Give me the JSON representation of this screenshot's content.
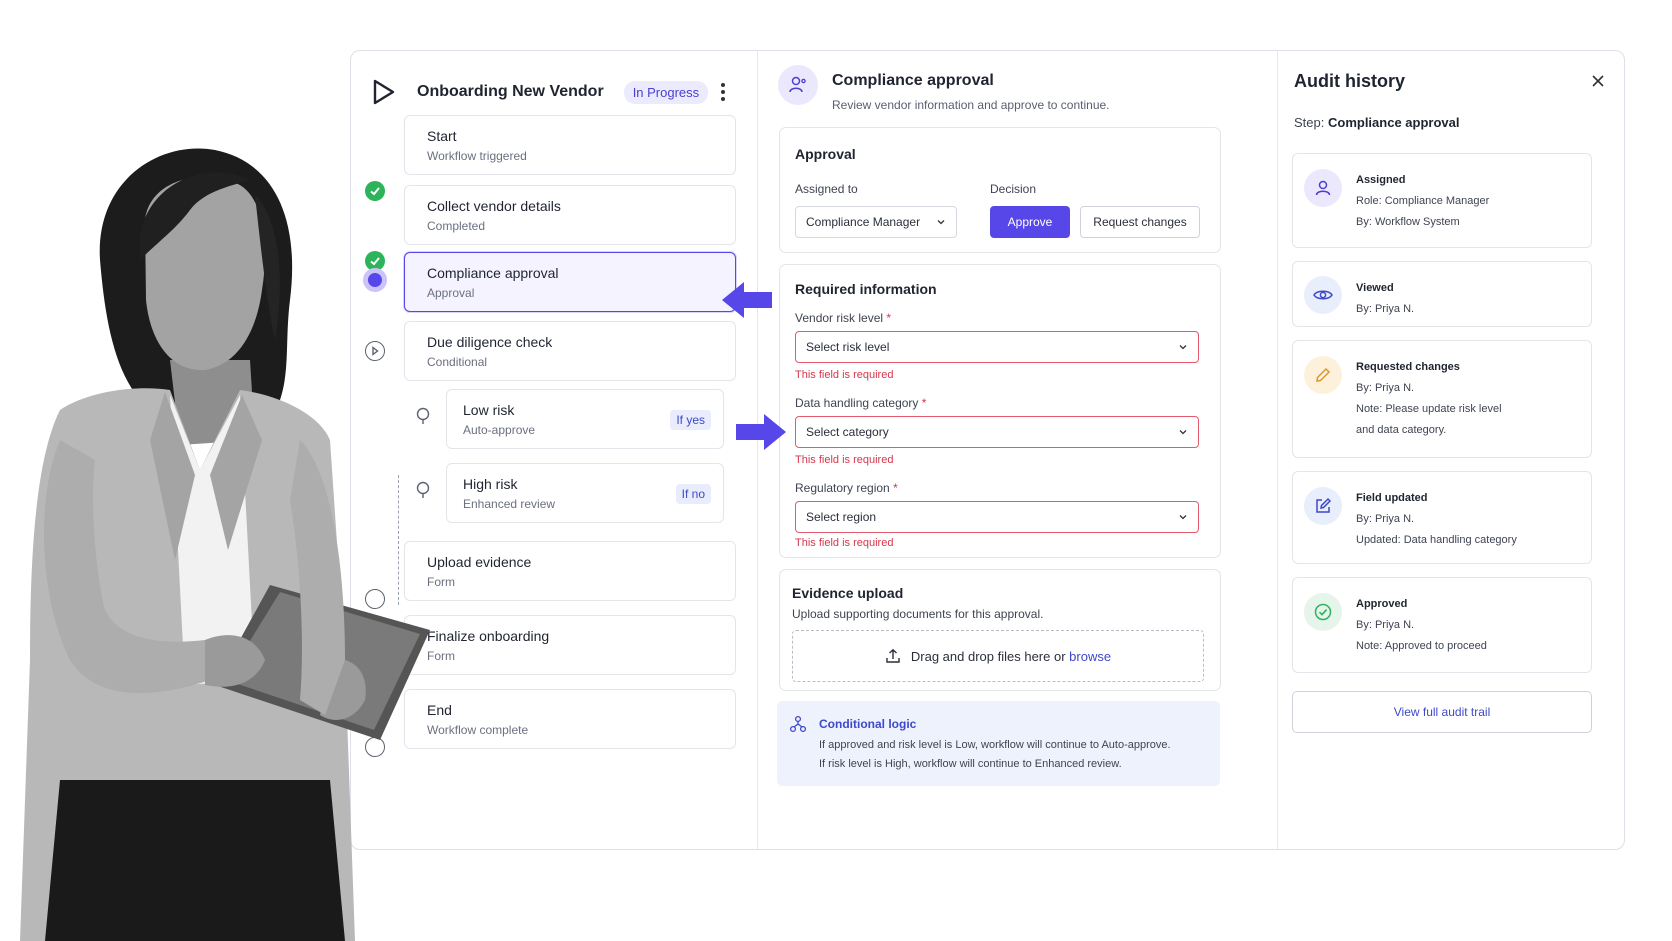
{
  "workflow": {
    "title": "Onboarding New Vendor",
    "status": "In Progress",
    "steps": [
      {
        "title": "Start",
        "subtitle": "Workflow triggered"
      },
      {
        "title": "Collect vendor details",
        "subtitle": "Completed"
      },
      {
        "title": "Compliance approval",
        "subtitle": "Approval"
      },
      {
        "title": "Due diligence check",
        "subtitle": "Conditional"
      },
      {
        "title": "Low risk",
        "subtitle": "Auto-approve",
        "badge": "If yes"
      },
      {
        "title": "High risk",
        "subtitle": "Enhanced review",
        "badge": "If no"
      },
      {
        "title": "Upload evidence",
        "subtitle": "Form"
      },
      {
        "title": "Finalize onboarding",
        "subtitle": "Form"
      },
      {
        "title": "End",
        "subtitle": "Workflow complete"
      }
    ]
  },
  "detail": {
    "title": "Compliance approval",
    "subtitle": "Review vendor information and approve to continue.",
    "approval": {
      "title": "Approval",
      "assigned_label": "Assigned to",
      "assigned_value": "Compliance Manager",
      "decision_label": "Decision",
      "approve_label": "Approve",
      "request_label": "Request changes"
    },
    "required": {
      "title": "Required information",
      "fields": [
        {
          "label": "Vendor risk level",
          "placeholder": "Select risk level",
          "error": "This field is required"
        },
        {
          "label": "Data handling category",
          "placeholder": "Select category",
          "error": "This field is required"
        },
        {
          "label": "Regulatory region",
          "placeholder": "Select region",
          "error": "This field is required"
        }
      ],
      "asterisk": "*"
    },
    "evidence": {
      "title": "Evidence upload",
      "subtitle": "Upload supporting documents for this approval.",
      "drop_text": "Drag and drop files here or",
      "browse": "browse"
    },
    "logic": {
      "title": "Conditional logic",
      "line1": "If approved and risk level is Low, workflow will continue to Auto-approve.",
      "line2": "If risk level is High, workflow will continue to Enhanced review."
    }
  },
  "audit": {
    "title": "Audit history",
    "step_label": "Step:",
    "step_value": "Compliance approval",
    "events": [
      {
        "title": "Assigned",
        "lines": [
          "Role: Compliance Manager",
          "By: Workflow System"
        ],
        "icon": "user-icon",
        "color": "#ebe8fd"
      },
      {
        "title": "Viewed",
        "lines": [
          "By: Priya N."
        ],
        "icon": "eye-icon",
        "color": "#e8eefc"
      },
      {
        "title": "Requested changes",
        "lines": [
          "By: Priya N.",
          "Note: Please update risk level",
          "and data category."
        ],
        "icon": "pencil-icon",
        "color": "#fdf1dc"
      },
      {
        "title": "Field updated",
        "lines": [
          "By: Priya N.",
          "Updated: Data handling category"
        ],
        "icon": "edit-icon",
        "color": "#e8eefc"
      },
      {
        "title": "Approved",
        "lines": [
          "By: Priya N.",
          "Note: Approved to proceed"
        ],
        "icon": "check-circle-icon",
        "color": "#e5f5ea"
      }
    ],
    "view_all": "View full audit trail"
  },
  "colors": {
    "accent": "#5746e8",
    "success": "#2db45b",
    "error": "#d6364b",
    "link": "#3d49c9"
  }
}
